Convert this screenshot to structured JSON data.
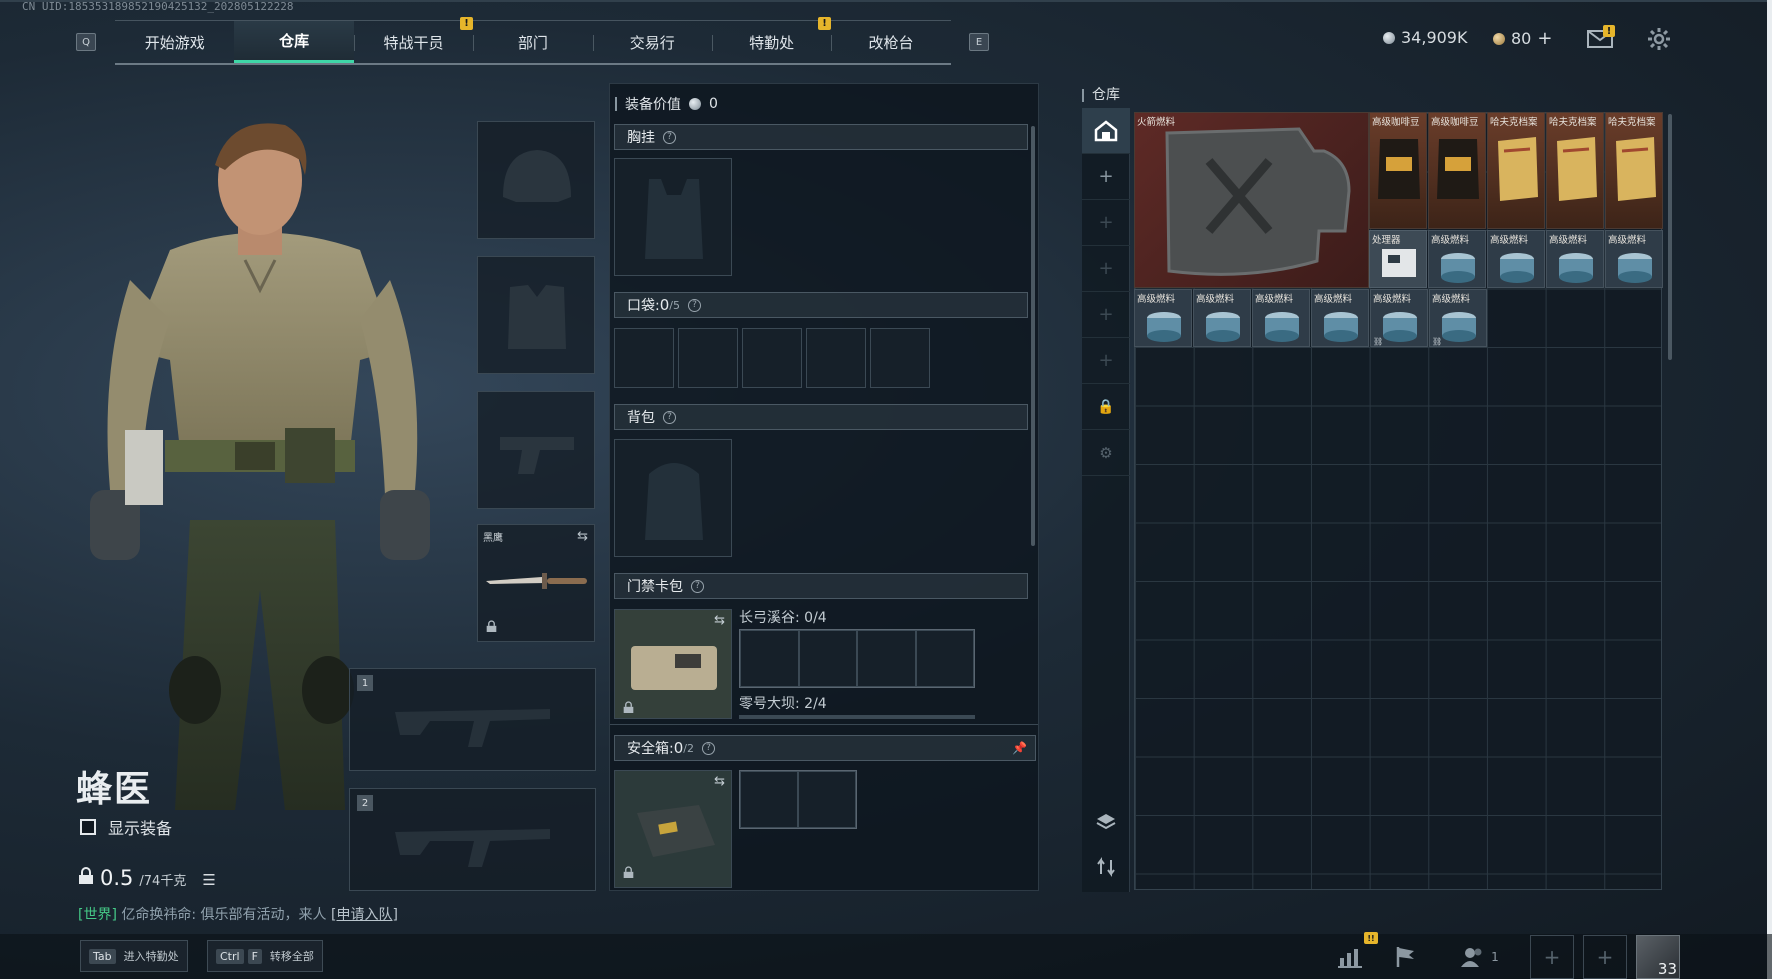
{
  "uid": "CN UID:1853531898521904251​32_20280512​2228",
  "nav": {
    "left_key": "Q",
    "right_key": "E",
    "tabs": [
      {
        "label": "开始游戏"
      },
      {
        "label": "仓库"
      },
      {
        "label": "特战干员",
        "alert": "!"
      },
      {
        "label": "部门"
      },
      {
        "label": "交易行"
      },
      {
        "label": "特勤处",
        "alert": "!"
      },
      {
        "label": "改枪台"
      }
    ]
  },
  "currency": {
    "silver": "34,909K",
    "gold": "80",
    "gold_add": "+",
    "mail_alert": "!"
  },
  "character": {
    "name": "蜂医",
    "show_equipment": "显示装备",
    "weight": "0.5",
    "weight_max": "/74千克"
  },
  "equip_slots": {
    "melee_label": "黑鹰",
    "weapon1_index": "1",
    "weapon2_index": "2"
  },
  "loadout": {
    "value_label": "装备价值",
    "value": "0",
    "chest_rig": "胸挂",
    "pockets": "口袋:",
    "pockets_count": "0",
    "pockets_max": "/5",
    "backpack": "背包",
    "keycard": "门禁卡包",
    "keycard_valley": "长弓溪谷: 0/4",
    "keycard_dam": "零号大坝: 2/4",
    "safebox": "安全箱:",
    "safebox_count": "0",
    "safebox_max": "/2"
  },
  "storage": {
    "title": "仓库",
    "items": [
      {
        "label": "火箭燃料"
      },
      {
        "label": "高级咖啡豆"
      },
      {
        "label": "高级咖啡豆"
      },
      {
        "label": "哈夫克档案"
      },
      {
        "label": "哈夫克档案"
      },
      {
        "label": "哈夫克档案"
      },
      {
        "label": "处理器"
      },
      {
        "label": "高级燃料"
      },
      {
        "label": "高级燃料"
      },
      {
        "label": "高级燃料"
      },
      {
        "label": "高级燃料"
      },
      {
        "label": "高级燃料"
      },
      {
        "label": "高级燃料"
      },
      {
        "label": "高级燃料"
      },
      {
        "label": "高级燃料"
      },
      {
        "label": "高级燃料"
      },
      {
        "label": "高级燃料"
      }
    ]
  },
  "chat": {
    "channel": "[世界]",
    "message": " 亿命换祎命: 俱乐部有活动，来人",
    "link": "[申请入队]"
  },
  "bottom": {
    "tab_key": "Tab",
    "tab_label": "进入特勤处",
    "ctrl_key": "Ctrl",
    "f_key": "F",
    "ctrl_label": "转移全部",
    "friends_count": "1",
    "level": "33",
    "stats_alert": "!!"
  }
}
